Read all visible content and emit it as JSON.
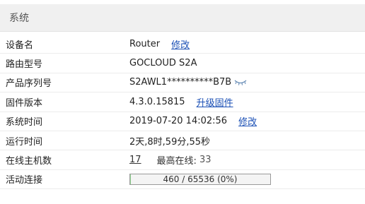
{
  "section": {
    "title": "系统"
  },
  "rows": {
    "device_name": {
      "label": "设备名",
      "value": "Router",
      "action": "修改"
    },
    "model": {
      "label": "路由型号",
      "value": "GOCLOUD S2A"
    },
    "serial": {
      "label": "产品序列号",
      "value": "S2AWL1**********B7B",
      "icon": "eye-closed-icon"
    },
    "firmware": {
      "label": "固件版本",
      "value": "4.3.0.15815",
      "action": "升级固件"
    },
    "system_time": {
      "label": "系统时间",
      "value": "2019-07-20 14:02:56",
      "action": "修改"
    },
    "uptime": {
      "label": "运行时间",
      "value": "2天,8时,59分,55秒"
    },
    "online_hosts": {
      "label": "在线主机数",
      "value": "17",
      "peak_label": "最高在线:",
      "peak_value": "33"
    },
    "connections": {
      "label": "活动连接",
      "text": "460 / 65536 (0%)",
      "fraction": 0.007
    }
  },
  "colors": {
    "link": "#1a4fb5",
    "header_bg": "#f0f0f0",
    "progress_fill": "#8fd18f"
  }
}
